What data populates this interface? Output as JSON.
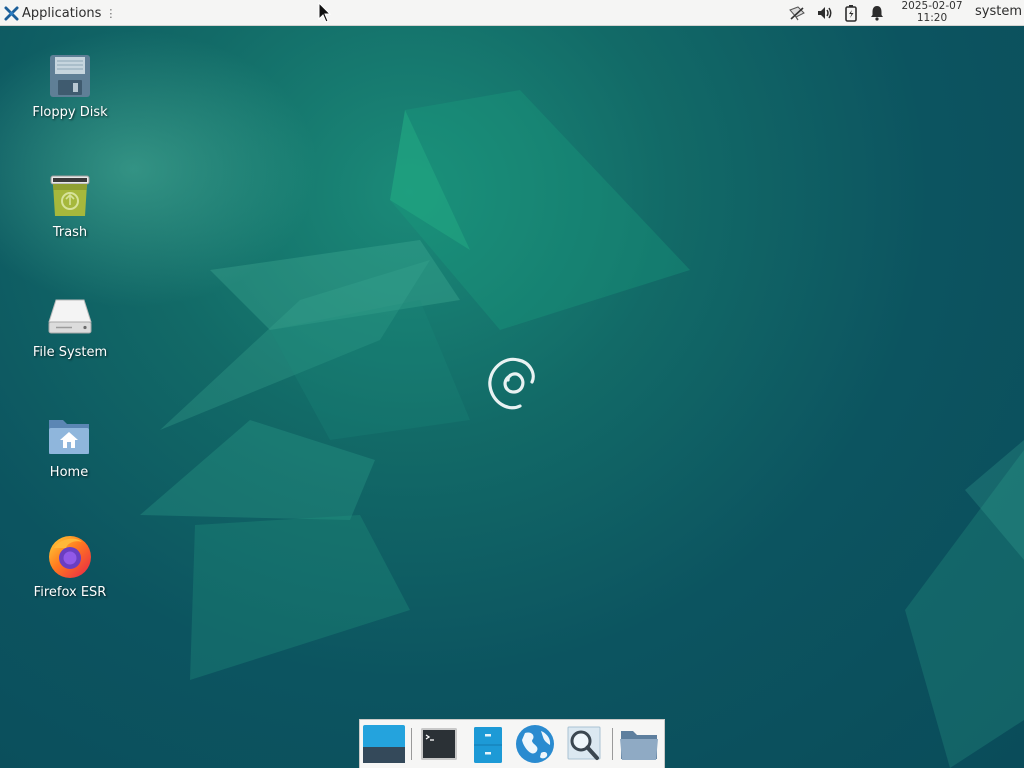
{
  "top_panel": {
    "applications_label": "Applications",
    "handle_glyph": "⋮",
    "tray": [
      "network-icon",
      "volume-icon",
      "battery-icon",
      "notification-bell-icon"
    ],
    "clock_date": "2025-02-07",
    "clock_time": "11:20",
    "user": "system"
  },
  "desktop_icons": [
    {
      "label": "Floppy Disk",
      "icon": "floppy-disk-icon"
    },
    {
      "label": "Trash",
      "icon": "trash-icon"
    },
    {
      "label": "File System",
      "icon": "drive-icon"
    },
    {
      "label": "Home",
      "icon": "home-folder-icon"
    },
    {
      "label": "Firefox ESR",
      "icon": "firefox-icon"
    }
  ],
  "dock": {
    "items": [
      "show-desktop",
      "terminal",
      "file-manager",
      "web-browser",
      "app-finder",
      "folder"
    ]
  },
  "colors": {
    "panel_bg": "#f5f5f4",
    "desktop_bg": "#0c5460",
    "accent": "#1d9ad6"
  }
}
